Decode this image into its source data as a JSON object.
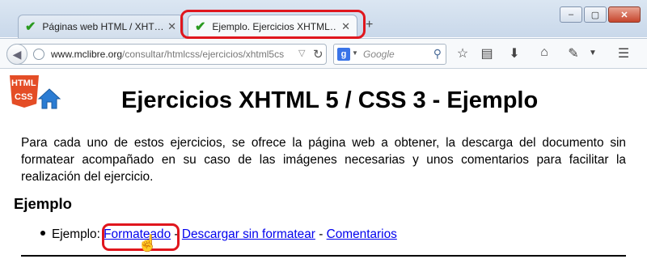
{
  "browser": {
    "tabs": [
      {
        "title": "Páginas web HTML / XHT…",
        "active": false
      },
      {
        "title": "Ejemplo. Ejercicios XHTML…",
        "active": true
      }
    ],
    "new_tab_icon": "+",
    "window_controls": {
      "minimize": "–",
      "maximize": "▢",
      "close": "✕"
    },
    "url": {
      "domain": "www.mclibre.org",
      "path": "/consultar/htmlcss/ejercicios/xhtml5cs"
    },
    "search": {
      "placeholder": "Google",
      "engine_letter": "g"
    },
    "toolbar_icons": [
      "star-icon",
      "reading-list-icon",
      "download-icon",
      "home-icon",
      "pen-icon",
      "menu-icon"
    ]
  },
  "page": {
    "logo": {
      "line1": "HTML",
      "line2": "CSS"
    },
    "title": "Ejercicios XHTML 5 / CSS 3 - Ejemplo",
    "intro": "Para cada uno de estos ejercicios, se ofrece la página web a obtener, la descarga del documento sin formatear acompañado en su caso de las imágenes necesarias y unos comentarios para facilitar la realización del ejercicio.",
    "section_heading": "Ejemplo",
    "item": {
      "prefix": "Ejemplo: ",
      "links": {
        "formatted": "Formateado",
        "download": "Descargar sin formatear",
        "comments": "Comentarios"
      },
      "separator": " - "
    }
  },
  "colors": {
    "highlight": "#e0161d",
    "link": "#0000ee",
    "html5_orange": "#e44d26",
    "house_blue": "#2b7cd3"
  }
}
